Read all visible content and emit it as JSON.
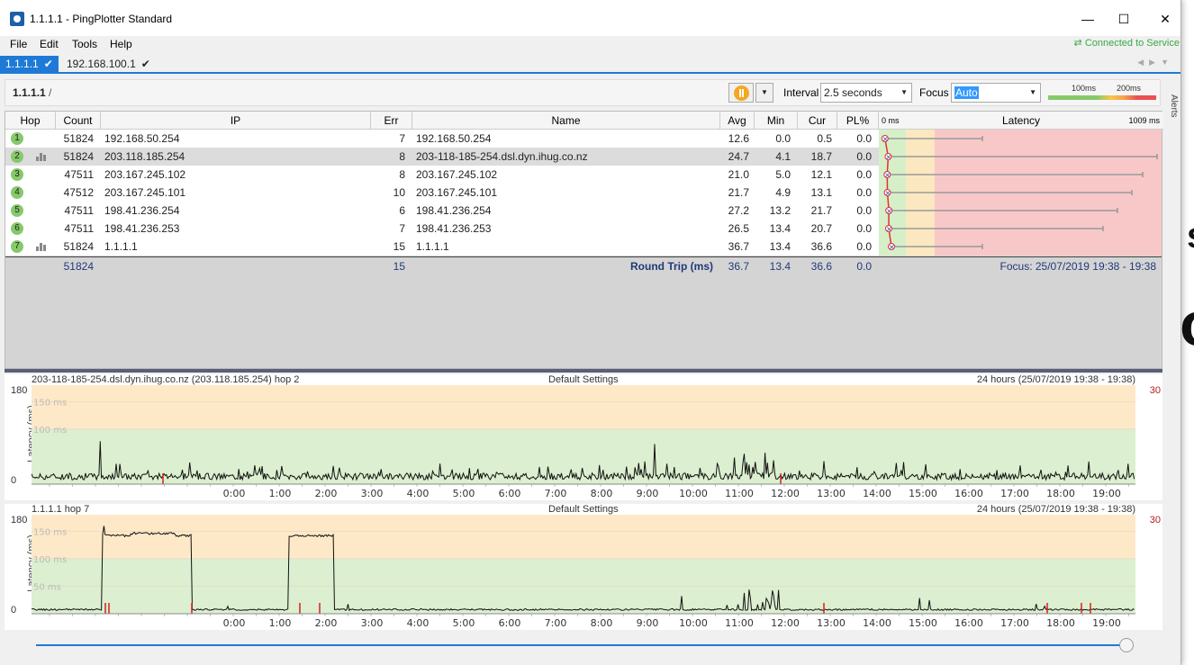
{
  "window": {
    "title": "1.1.1.1 - PingPlotter Standard",
    "minimize": "—",
    "maximize": "☐",
    "close": "✕"
  },
  "menu": {
    "items": [
      "File",
      "Edit",
      "Tools",
      "Help"
    ],
    "connected": "⇄ Connected to Service"
  },
  "tabs": [
    {
      "label": "1.1.1.1",
      "check": "✔",
      "active": true
    },
    {
      "label": "192.168.100.1",
      "check": "✔",
      "active": false
    }
  ],
  "toolbar": {
    "breadcrumb": "1.1.1.1",
    "breadcrumb_sep": "/",
    "interval_label": "Interval",
    "interval_value": "2.5 seconds",
    "focus_label": "Focus",
    "focus_value": "Auto",
    "scale_100": "100ms",
    "scale_200": "200ms",
    "alerts": "Alerts"
  },
  "grid": {
    "headers": {
      "hop": "Hop",
      "count": "Count",
      "ip": "IP",
      "err": "Err",
      "name": "Name",
      "avg": "Avg",
      "min": "Min",
      "cur": "Cur",
      "pl": "PL%",
      "latency": "Latency",
      "lat_min": "0 ms",
      "lat_max": "1009 ms"
    },
    "rows": [
      {
        "hop": "1",
        "count": "51824",
        "ip": "192.168.50.254",
        "err": "7",
        "name": "192.168.50.254",
        "avg": "12.6",
        "min": "0.0",
        "cur": "0.5",
        "pl": "0.0",
        "chart": false
      },
      {
        "hop": "2",
        "count": "51824",
        "ip": "203.118.185.254",
        "err": "8",
        "name": "203-118-185-254.dsl.dyn.ihug.co.nz",
        "avg": "24.7",
        "min": "4.1",
        "cur": "18.7",
        "pl": "0.0",
        "chart": true
      },
      {
        "hop": "3",
        "count": "47511",
        "ip": "203.167.245.102",
        "err": "8",
        "name": "203.167.245.102",
        "avg": "21.0",
        "min": "5.0",
        "cur": "12.1",
        "pl": "0.0",
        "chart": false
      },
      {
        "hop": "4",
        "count": "47512",
        "ip": "203.167.245.101",
        "err": "10",
        "name": "203.167.245.101",
        "avg": "21.7",
        "min": "4.9",
        "cur": "13.1",
        "pl": "0.0",
        "chart": false
      },
      {
        "hop": "5",
        "count": "47511",
        "ip": "198.41.236.254",
        "err": "6",
        "name": "198.41.236.254",
        "avg": "27.2",
        "min": "13.2",
        "cur": "21.7",
        "pl": "0.0",
        "chart": false
      },
      {
        "hop": "6",
        "count": "47511",
        "ip": "198.41.236.253",
        "err": "7",
        "name": "198.41.236.253",
        "avg": "26.5",
        "min": "13.4",
        "cur": "20.7",
        "pl": "0.0",
        "chart": false
      },
      {
        "hop": "7",
        "count": "51824",
        "ip": "1.1.1.1",
        "err": "15",
        "name": "1.1.1.1",
        "avg": "36.7",
        "min": "13.4",
        "cur": "36.6",
        "pl": "0.0",
        "chart": true
      }
    ],
    "total": {
      "count": "51824",
      "err": "15",
      "label": "Round Trip (ms)",
      "avg": "36.7",
      "min": "13.4",
      "cur": "36.6",
      "pl": "0.0",
      "focus": "Focus: 25/07/2019 19:38 - 19:38"
    },
    "latency_max_whisker": [
      115,
      309,
      293,
      281,
      265,
      249,
      115
    ]
  },
  "timelines": [
    {
      "left": "203-118-185-254.dsl.dyn.ihug.co.nz (203.118.185.254) hop 2",
      "mid": "Default Settings",
      "right": "24 hours (25/07/2019 19:38 - 19:38)",
      "pl_max": "30",
      "ylabel": "Latency (ms)",
      "ytop": "180",
      "ybottom": "0",
      "bands": [
        "150 ms",
        "100 ms"
      ],
      "hours": [
        "0:00",
        "1:00",
        "2:00",
        "3:00",
        "4:00",
        "5:00",
        "6:00",
        "7:00",
        "8:00",
        "9:00",
        "10:00",
        "11:00",
        "12:00",
        "13:00",
        "14:00",
        "15:00",
        "16:00",
        "17:00",
        "18:00",
        "19:00"
      ]
    },
    {
      "left": "1.1.1.1 hop 7",
      "mid": "Default Settings",
      "right": "24 hours (25/07/2019 19:38 - 19:38)",
      "pl_max": "30",
      "ylabel": "Latency (ms)",
      "ytop": "180",
      "ybottom": "0",
      "bands": [
        "150 ms",
        "100 ms",
        "50 ms"
      ],
      "hours": [
        "0:00",
        "1:00",
        "2:00",
        "3:00",
        "4:00",
        "5:00",
        "6:00",
        "7:00",
        "8:00",
        "9:00",
        "10:00",
        "11:00",
        "12:00",
        "13:00",
        "14:00",
        "15:00",
        "16:00",
        "17:00",
        "18:00",
        "19:00"
      ]
    }
  ],
  "colors": {
    "accent": "#1e7ad6",
    "good": "#86c96b",
    "warn": "#f6c64d",
    "bad": "#ea5050"
  }
}
